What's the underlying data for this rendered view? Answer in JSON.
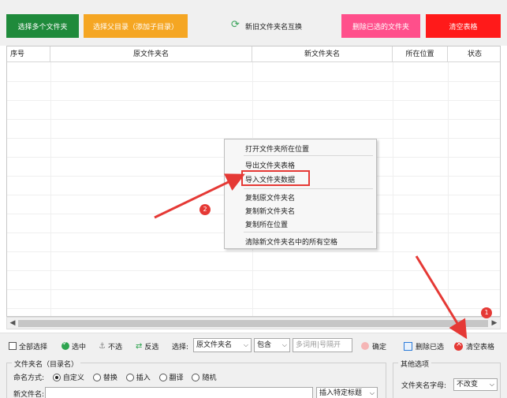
{
  "top_buttons": {
    "select_multiple": "选择多个文件夹",
    "select_parent": "选择父目录（添加子目录）",
    "swap_names": "新旧文件夹名互换",
    "delete_selected": "删除已选的文件夹",
    "clear_table": "清空表格"
  },
  "table": {
    "headers": [
      "序号",
      "原文件夹名",
      "新文件夹名",
      "所在位置",
      "状态"
    ]
  },
  "context_menu": {
    "items": [
      "打开文件夹所在位置",
      "导出文件夹表格",
      "导入文件夹数据",
      "复制原文件夹名",
      "复制新文件夹名",
      "复制所在位置",
      "清除新文件夹名中的所有空格"
    ]
  },
  "toolbar": {
    "select_all": "全部选择",
    "check": "选中",
    "uncheck": "不选",
    "invert": "反选",
    "select_label": "选择:",
    "select_field_value": "原文件夹名",
    "match_value": "包含",
    "keyword_placeholder": "多词用|号隔开",
    "confirm": "确定",
    "delete_selected": "删除已选",
    "clear_table": "清空表格"
  },
  "bottom": {
    "group_title": "文件夹名（目录名）",
    "naming_label": "命名方式:",
    "naming_options": [
      "自定义",
      "替换",
      "插入",
      "翻译",
      "随机"
    ],
    "new_name_label": "新文件名:",
    "insert_title": "插入特定标题",
    "other_group_title": "其他选项",
    "case_label": "文件夹名字母:",
    "case_value": "不改变"
  },
  "badges": {
    "one": "1",
    "two": "2"
  },
  "colors": {
    "green": "#1f8a3b",
    "orange": "#f5a623",
    "pink": "#ff4f8b",
    "red": "#ff1a1a",
    "annotation": "#e53935"
  }
}
